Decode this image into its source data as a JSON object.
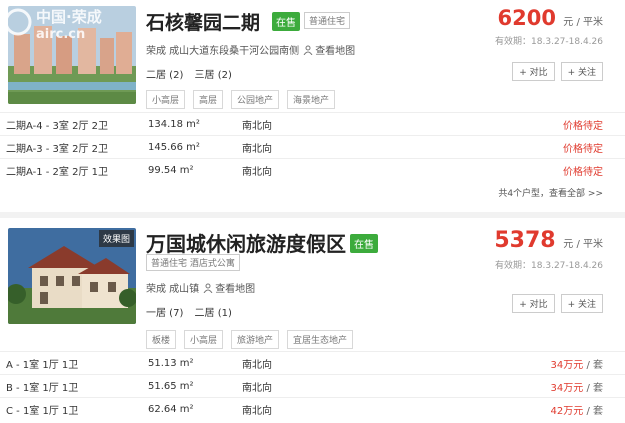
{
  "watermark": {
    "cn": "中国·荣成",
    "en": "airc.cn"
  },
  "listing_1": {
    "title": "石核馨园二期",
    "sale_status": "在售",
    "type": "普通住宅",
    "price": "6200",
    "price_unit": "元 / 平米",
    "validity": "有效期：18.3.27-18.4.26",
    "address": "荣成 成山大道东段桑干河公园南侧",
    "map_link": "查看地图",
    "layouts": [
      "二居 (2)",
      "三居 (2)"
    ],
    "compare_label": "+ 对比",
    "follow_label": "+ 关注",
    "tags": [
      "小高层",
      "高层",
      "公园地产",
      "海景地产"
    ],
    "units": [
      {
        "name": "二期A-4 - 3室 2厅 2卫",
        "area": "134.18 m²",
        "orientation": "南北向",
        "price": "价格待定"
      },
      {
        "name": "二期A-3 - 3室 2厅 2卫",
        "area": "145.66 m²",
        "orientation": "南北向",
        "price": "价格待定"
      },
      {
        "name": "二期A-1 - 2室 2厅 1卫",
        "area": "99.54 m²",
        "orientation": "南北向",
        "price": "价格待定"
      }
    ],
    "more_link": "共4个户型，查看全部 >>"
  },
  "listing_2": {
    "effect_badge": "效果图",
    "title": "万国城休闲旅游度假区",
    "sale_status": "在售",
    "type": "普通住宅 酒店式公寓",
    "price": "5378",
    "price_unit": "元 / 平米",
    "validity": "有效期：18.3.27-18.4.26",
    "address": "荣成 成山镇",
    "map_link": "查看地图",
    "layouts": [
      "一居 (7)",
      "二居 (1)"
    ],
    "compare_label": "+ 对比",
    "follow_label": "+ 关注",
    "tags": [
      "板楼",
      "小高层",
      "旅游地产",
      "宜居生态地产"
    ],
    "units": [
      {
        "name": "A - 1室 1厅 1卫",
        "area": "51.13 m²",
        "orientation": "南北向",
        "price": "34万元",
        "per": " / 套"
      },
      {
        "name": "B - 1室 1厅 1卫",
        "area": "51.65 m²",
        "orientation": "南北向",
        "price": "34万元",
        "per": " / 套"
      },
      {
        "name": "C - 1室 1厅 1卫",
        "area": "62.64 m²",
        "orientation": "南北向",
        "price": "42万元",
        "per": " / 套"
      }
    ]
  }
}
